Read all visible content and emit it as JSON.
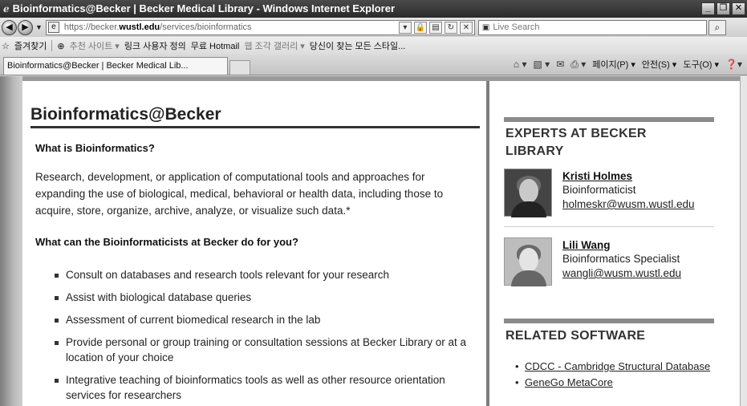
{
  "window": {
    "title": "Bioinformatics@Becker | Becker Medical Library - Windows Internet Explorer",
    "buttons": [
      "_",
      "❐",
      "✕"
    ]
  },
  "nav": {
    "url_prefix": "https://becker.",
    "url_domain": "wustl.edu",
    "url_path": "/services/bioinformatics",
    "search_placeholder": "Live Search"
  },
  "favorites": {
    "label": "즐겨찾기",
    "items": [
      "추천 사이트 ▾",
      "링크 사용자 정의",
      "무료 Hotmail",
      "웹 조각 갤러리 ▾",
      "당신이 찾는 모든 스타일..."
    ]
  },
  "tab": {
    "label": "Bioinformatics@Becker | Becker Medical Lib...",
    "commands": [
      "페이지(P) ▾",
      "안전(S) ▾",
      "도구(O) ▾"
    ]
  },
  "main": {
    "title": "Bioinformatics@Becker",
    "q1": "What is Bioinformatics?",
    "p1_line1": "Research, development, or application of computational tools and approaches for",
    "p1_line2": "expanding the use of biological, medical, behavioral or health data, including those to",
    "p1_line3": "acquire, store, organize, archive, analyze, or visualize such data.*",
    "q2": "What can the Bioinformaticists at Becker do for you?",
    "services": [
      "Consult on databases and research tools relevant for your research",
      "Assist with biological database queries",
      "Assessment of current biomedical research in the lab",
      "Provide personal or group training or consultation sessions at Becker Library or at a location of your choice",
      "Integrative teaching of bioinformatics tools as well as other resource orientation services for researchers"
    ]
  },
  "sidebar": {
    "experts_heading": "EXPERTS AT BECKER LIBRARY",
    "experts": [
      {
        "name": "Kristi Holmes",
        "role": "Bioinformaticist",
        "email": "holmeskr@wusm.wustl.edu"
      },
      {
        "name": "Lili Wang",
        "role": "Bioinformatics Specialist",
        "email": "wangli@wusm.wustl.edu"
      }
    ],
    "software_heading": "RELATED SOFTWARE",
    "software": [
      "CDCC - Cambridge Structural Database",
      "GeneGo MetaCore"
    ]
  }
}
